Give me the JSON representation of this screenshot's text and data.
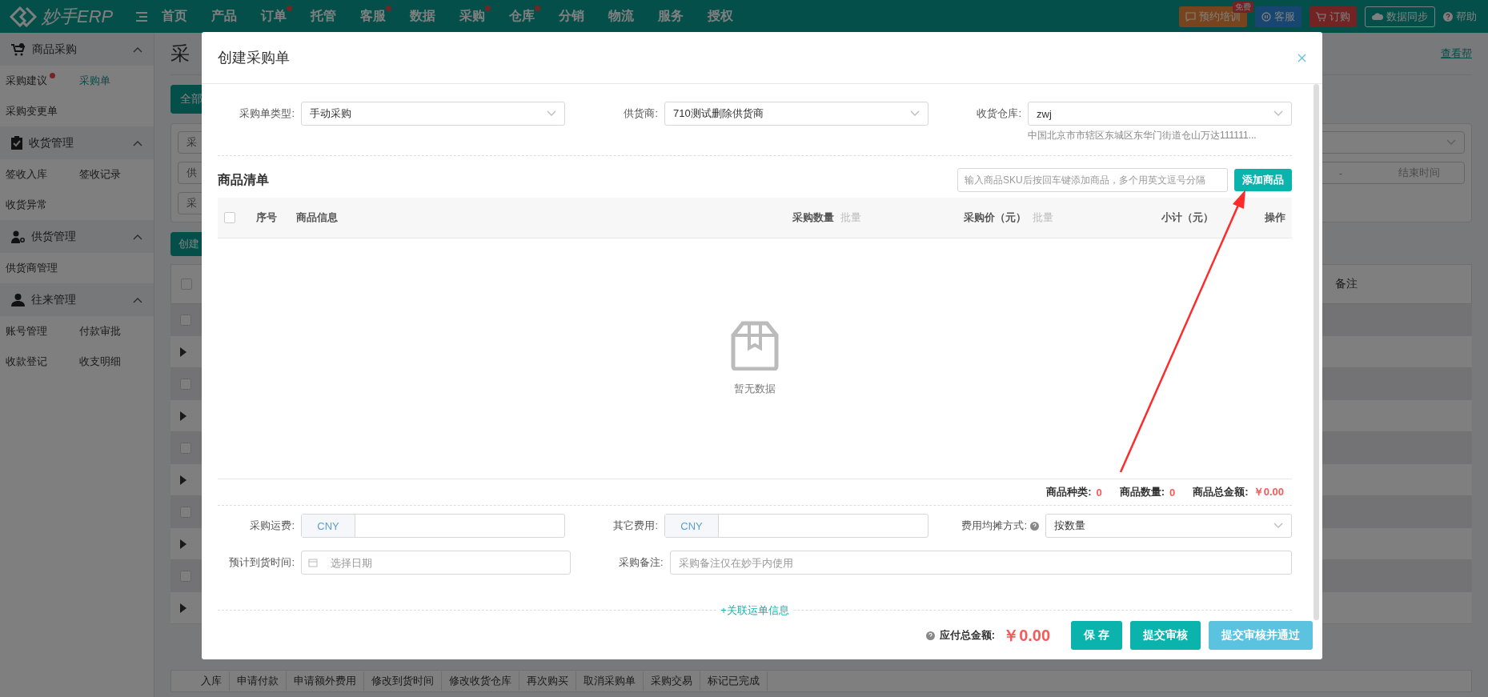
{
  "topbar": {
    "logo": "妙手ERP",
    "nav": [
      {
        "label": "首页",
        "dot": false
      },
      {
        "label": "产品",
        "dot": false
      },
      {
        "label": "订单",
        "dot": true
      },
      {
        "label": "托管",
        "dot": false
      },
      {
        "label": "客服",
        "dot": true
      },
      {
        "label": "数据",
        "dot": false
      },
      {
        "label": "采购",
        "dot": true
      },
      {
        "label": "仓库",
        "dot": true
      },
      {
        "label": "分销",
        "dot": false
      },
      {
        "label": "物流",
        "dot": false
      },
      {
        "label": "服务",
        "dot": false
      },
      {
        "label": "授权",
        "dot": false
      }
    ],
    "actions": [
      {
        "kind": "training",
        "label": "预约培训",
        "badge": "免费"
      },
      {
        "kind": "service",
        "label": "客服"
      },
      {
        "kind": "order",
        "label": "订购"
      },
      {
        "kind": "sync",
        "label": "数据同步"
      },
      {
        "kind": "help",
        "label": "帮助"
      }
    ]
  },
  "sidebar": {
    "groups": [
      {
        "title": "商品采购",
        "kind": "cart",
        "expanded": true,
        "items": [
          {
            "label": "采购建议",
            "selected": false,
            "dot": true
          },
          {
            "label": "采购单",
            "selected": true,
            "dot": false
          },
          {
            "label": "采购变更单",
            "selected": false,
            "dot": false
          }
        ]
      },
      {
        "title": "收货管理",
        "kind": "clipboard",
        "expanded": true,
        "items": [
          {
            "label": "签收入库",
            "selected": false,
            "dot": false
          },
          {
            "label": "签收记录",
            "selected": false,
            "dot": false
          },
          {
            "label": "收货异常",
            "selected": false,
            "dot": false
          }
        ]
      },
      {
        "title": "供货管理",
        "kind": "supplier",
        "expanded": true,
        "items": [
          {
            "label": "供货商管理",
            "selected": false,
            "dot": false
          }
        ]
      },
      {
        "title": "往来管理",
        "kind": "person",
        "expanded": true,
        "items": [
          {
            "label": "账号管理",
            "selected": false,
            "dot": false
          },
          {
            "label": "付款审批",
            "selected": false,
            "dot": false
          },
          {
            "label": "收款登记",
            "selected": false,
            "dot": false
          },
          {
            "label": "收支明细",
            "selected": false,
            "dot": false
          }
        ]
      }
    ]
  },
  "background": {
    "page_title": "采",
    "table": {
      "checked": false,
      "rows": [
        {
          "checked": false
        },
        {
          "checked": false
        },
        {
          "checked": false
        },
        {
          "checked": false
        },
        {
          "checked": false
        }
      ]
    },
    "help_link": "查看帮",
    "tab": "全部",
    "filters": [
      "采",
      "供",
      "采"
    ],
    "date_separator": "-",
    "end_time_placeholder": "结束时间",
    "create_button": "创建",
    "column_header": "备注",
    "action_bar": [
      "入库",
      "申请付款",
      "申请额外费用",
      "修改到货时间",
      "修改收货仓库",
      "再次购买",
      "取消采购单",
      "采购交易",
      "标记已完成"
    ]
  },
  "modal": {
    "title": "创建采购单",
    "header_fields": [
      {
        "label": "采购单类型:",
        "value": "手动采购",
        "kind": "select"
      },
      {
        "label": "供货商:",
        "value": "710测试删除供货商",
        "kind": "select"
      },
      {
        "label": "收货仓库:",
        "value": "zwj",
        "kind": "select",
        "note": "中国北京市市辖区东城区东华门街道仓山万达111111..."
      }
    ],
    "section_title": "商品清单",
    "sku_search": {
      "placeholder": "输入商品SKU后按回车键添加商品，多个用英文逗号分隔"
    },
    "add_button": "添加商品",
    "table": {
      "checked": false,
      "columns": [
        {
          "label": "序号"
        },
        {
          "label": "商品信息"
        },
        {
          "label": "采购数量",
          "batch": "批量"
        },
        {
          "label": "采购价（元）",
          "batch": "批量"
        },
        {
          "label": "小计（元）"
        },
        {
          "label": "操作"
        }
      ],
      "empty": "暂无数据"
    },
    "totals": [
      {
        "label": "商品种类:",
        "value": "0"
      },
      {
        "label": "商品数量:",
        "value": "0"
      },
      {
        "label": "商品总金额:",
        "value": "￥0.00"
      }
    ],
    "fee_fields": [
      {
        "label": "采购运费:",
        "kind": "currency",
        "prefix": "CNY"
      },
      {
        "label": "其它费用:",
        "kind": "currency",
        "prefix": "CNY"
      },
      {
        "label": "费用均摊方式:",
        "kind": "select",
        "help": true,
        "value": "按数量"
      }
    ],
    "extra_fields": [
      {
        "label": "预计到货时间:",
        "kind": "date",
        "placeholder": "选择日期"
      },
      {
        "label": "采购备注:",
        "kind": "text",
        "placeholder": "采购备注仅在妙手内使用"
      }
    ],
    "link": "+关联运单信息",
    "footer": {
      "total_label": "应付总金额:",
      "total": "￥0.00",
      "buttons": [
        {
          "label": "保 存",
          "kind": "primary"
        },
        {
          "label": "提交审核",
          "kind": "primary"
        },
        {
          "label": "提交审核并通过",
          "kind": "light"
        }
      ]
    }
  }
}
